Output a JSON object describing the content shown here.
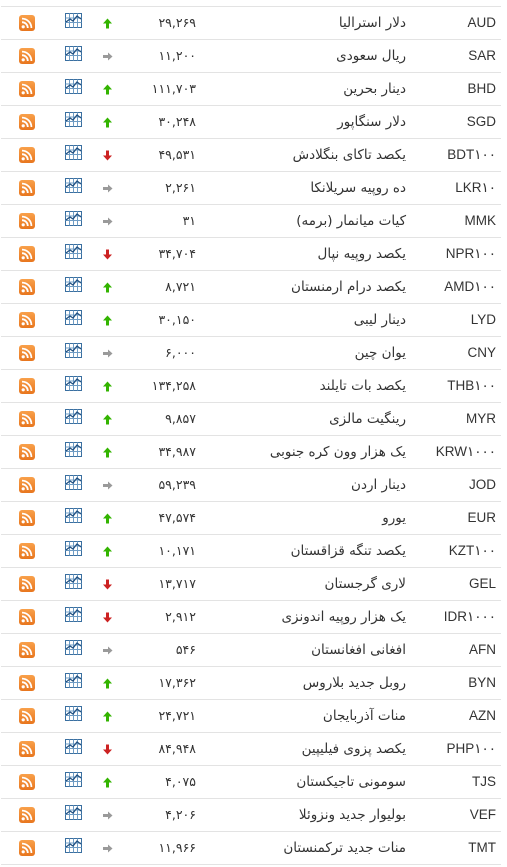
{
  "colors": {
    "up": "#33b400",
    "down": "#cc2222",
    "flat": "#9a9a9a",
    "rss": "#ee8024",
    "chart": "#3a6fa0"
  },
  "rows": [
    {
      "code": "AUD",
      "name": "دلار استرالیا",
      "price": "۲۹,۲۶۹",
      "trend": "up"
    },
    {
      "code": "SAR",
      "name": "ریال سعودی",
      "price": "۱۱,۲۰۰",
      "trend": "flat"
    },
    {
      "code": "BHD",
      "name": "دینار بحرین",
      "price": "۱۱۱,۷۰۳",
      "trend": "up"
    },
    {
      "code": "SGD",
      "name": "دلار سنگاپور",
      "price": "۳۰,۲۴۸",
      "trend": "up"
    },
    {
      "code": "BDT۱۰۰",
      "name": "یکصد تاکای بنگلادش",
      "price": "۴۹,۵۳۱",
      "trend": "down"
    },
    {
      "code": "LKR۱۰",
      "name": "ده روپیه سریلانکا",
      "price": "۲,۲۶۱",
      "trend": "flat"
    },
    {
      "code": "MMK",
      "name": "کیات میانمار (برمه)",
      "price": "۳۱",
      "trend": "flat"
    },
    {
      "code": "NPR۱۰۰",
      "name": "یکصد روپیه نپال",
      "price": "۳۴,۷۰۴",
      "trend": "down"
    },
    {
      "code": "AMD۱۰۰",
      "name": "یکصد درام ارمنستان",
      "price": "۸,۷۲۱",
      "trend": "up"
    },
    {
      "code": "LYD",
      "name": "دینار لیبی",
      "price": "۳۰,۱۵۰",
      "trend": "up"
    },
    {
      "code": "CNY",
      "name": "یوان چین",
      "price": "۶,۰۰۰",
      "trend": "flat"
    },
    {
      "code": "THB۱۰۰",
      "name": "یکصد بات تایلند",
      "price": "۱۳۴,۲۵۸",
      "trend": "up"
    },
    {
      "code": "MYR",
      "name": "رینگیت مالزی",
      "price": "۹,۸۵۷",
      "trend": "up"
    },
    {
      "code": "KRW۱۰۰۰",
      "name": "یک هزار وون کره جنوبی",
      "price": "۳۴,۹۸۷",
      "trend": "up"
    },
    {
      "code": "JOD",
      "name": "دینار اردن",
      "price": "۵۹,۲۳۹",
      "trend": "flat"
    },
    {
      "code": "EUR",
      "name": "یورو",
      "price": "۴۷,۵۷۴",
      "trend": "up"
    },
    {
      "code": "KZT۱۰۰",
      "name": "یکصد تنگه قزاقستان",
      "price": "۱۰,۱۷۱",
      "trend": "up"
    },
    {
      "code": "GEL",
      "name": "لاری گرجستان",
      "price": "۱۳,۷۱۷",
      "trend": "down"
    },
    {
      "code": "IDR۱۰۰۰",
      "name": "یک هزار روپیه اندونزی",
      "price": "۲,۹۱۲",
      "trend": "down"
    },
    {
      "code": "AFN",
      "name": "افغانی افغانستان",
      "price": "۵۴۶",
      "trend": "flat"
    },
    {
      "code": "BYN",
      "name": "روبل جدید بلاروس",
      "price": "۱۷,۳۶۲",
      "trend": "up"
    },
    {
      "code": "AZN",
      "name": "منات آذربایجان",
      "price": "۲۴,۷۲۱",
      "trend": "up"
    },
    {
      "code": "PHP۱۰۰",
      "name": "یکصد پزوی فیلیپین",
      "price": "۸۴,۹۴۸",
      "trend": "down"
    },
    {
      "code": "TJS",
      "name": "سومونی تاجیکستان",
      "price": "۴,۰۷۵",
      "trend": "up"
    },
    {
      "code": "VEF",
      "name": "بولیوار جدید ونزوئلا",
      "price": "۴,۲۰۶",
      "trend": "flat"
    },
    {
      "code": "TMT",
      "name": "منات جدید ترکمنستان",
      "price": "۱۱,۹۶۶",
      "trend": "flat"
    }
  ]
}
